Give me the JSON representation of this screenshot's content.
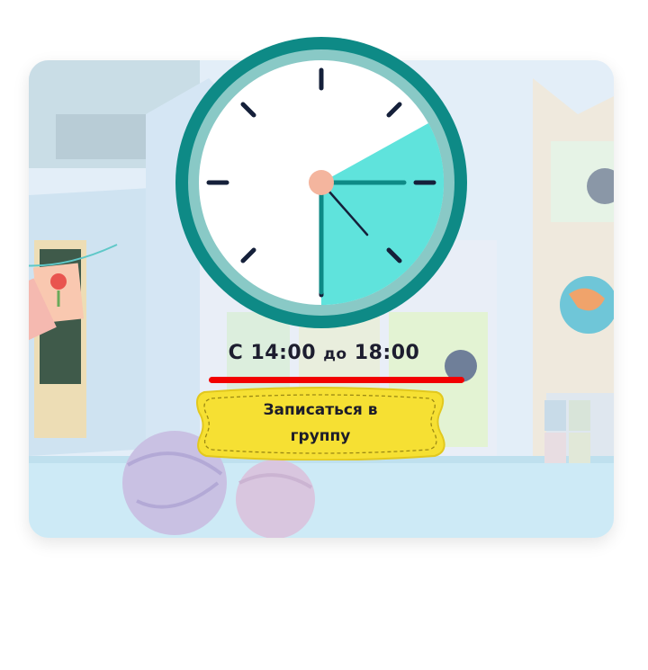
{
  "schedule": {
    "prefix": "С",
    "start": "14:00",
    "mid": "до",
    "end": "18:00"
  },
  "signup_button": {
    "label": "Записаться в группу"
  },
  "clock": {
    "hour_hand_points_to": 3,
    "minute_hand_points_to_minutes": 24,
    "highlighted_sector": [
      "14:00",
      "18:00"
    ]
  },
  "colors": {
    "clock_rim": "#0e8a86",
    "clock_rim_inner": "#89c9c6",
    "clock_sector": "#5fe3dc",
    "clock_face": "#ffffff",
    "ticks": "#15203a",
    "hub": "#f4b59e",
    "underline": "#f20000",
    "button": "#f6e033"
  }
}
